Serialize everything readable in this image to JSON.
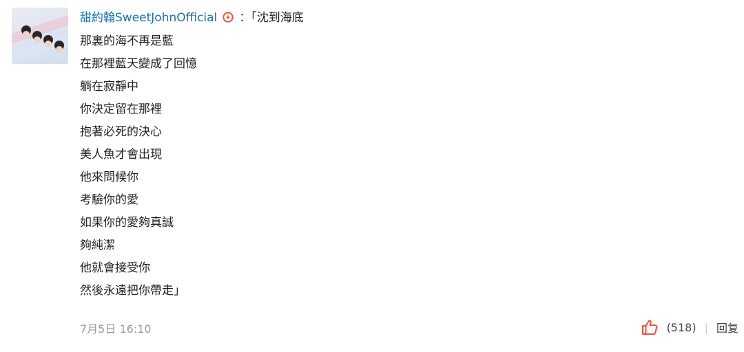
{
  "comment": {
    "username": "甜約翰SweetJohnOfficial",
    "badge_icon": "weibo-music-badge-icon",
    "badge_color": "#e8543f",
    "colon": "：",
    "lines": [
      "「沈到海底",
      "那裏的海不再是藍",
      "在那裡藍天變成了回憶",
      "躺在寂靜中",
      "你決定留在那裡",
      "抱著必死的決心",
      "美人魚才會出現",
      "他來問候你",
      "考驗你的愛",
      "如果你的愛夠真誠",
      "夠純潔",
      "他就會接受你",
      "然後永遠把你帶走」"
    ],
    "timestamp": "7月5日 16:10",
    "like_icon": "thumbs-up-icon",
    "like_icon_color": "#e8543f",
    "like_count": "(518)",
    "divider": "|",
    "reply_label": "回复"
  }
}
